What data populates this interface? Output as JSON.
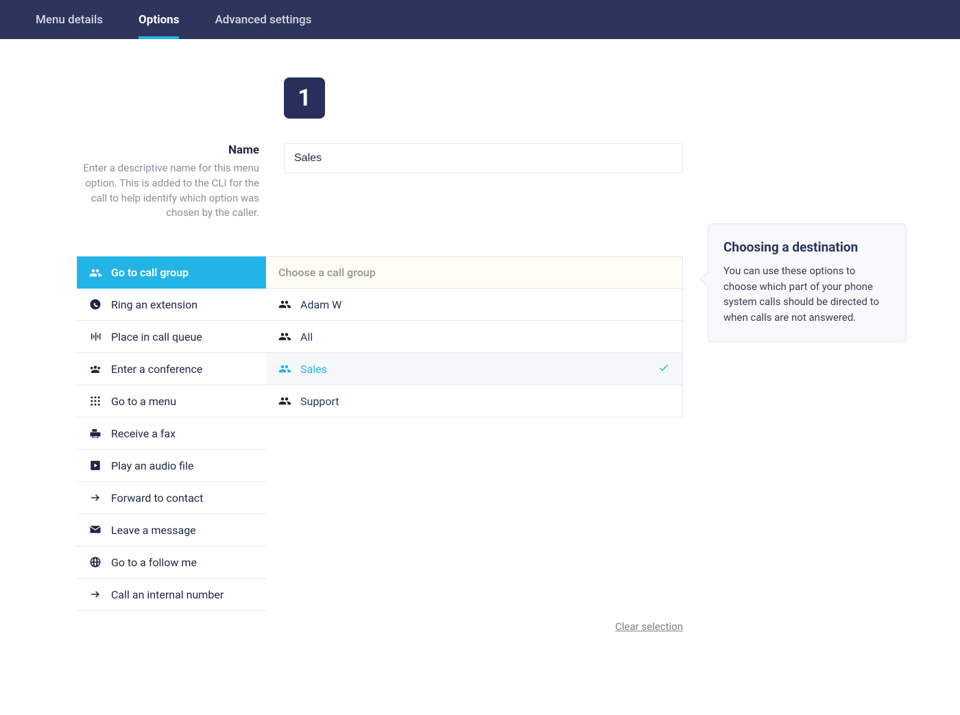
{
  "nav": {
    "tabs": [
      {
        "label": "Menu details",
        "active": false
      },
      {
        "label": "Options",
        "active": true
      },
      {
        "label": "Advanced settings",
        "active": false
      }
    ]
  },
  "option_number": "1",
  "name_field": {
    "label": "Name",
    "help": "Enter a descriptive name for this menu option. This is added to the CLI for the call to help identify which option was chosen by the caller.",
    "value": "Sales"
  },
  "dest_types": [
    {
      "icon": "group",
      "label": "Go to call group",
      "active": true
    },
    {
      "icon": "phone",
      "label": "Ring an extension",
      "active": false
    },
    {
      "icon": "queue",
      "label": "Place in call queue",
      "active": false
    },
    {
      "icon": "conference",
      "label": "Enter a conference",
      "active": false
    },
    {
      "icon": "grid",
      "label": "Go to a menu",
      "active": false
    },
    {
      "icon": "fax",
      "label": "Receive a fax",
      "active": false
    },
    {
      "icon": "play",
      "label": "Play an audio file",
      "active": false
    },
    {
      "icon": "arrow",
      "label": "Forward to contact",
      "active": false
    },
    {
      "icon": "message",
      "label": "Leave a message",
      "active": false
    },
    {
      "icon": "globe",
      "label": "Go to a follow me",
      "active": false
    },
    {
      "icon": "arrow",
      "label": "Call an internal number",
      "active": false
    }
  ],
  "choose": {
    "header": "Choose a call group",
    "rows": [
      {
        "label": "Adam W",
        "selected": false
      },
      {
        "label": "All",
        "selected": false
      },
      {
        "label": "Sales",
        "selected": true
      },
      {
        "label": "Support",
        "selected": false
      }
    ]
  },
  "clear_label": "Clear selection",
  "help_panel": {
    "title": "Choosing a destination",
    "body": "You can use these options to choose which part of your phone system calls should be directed to when calls are not answered."
  }
}
